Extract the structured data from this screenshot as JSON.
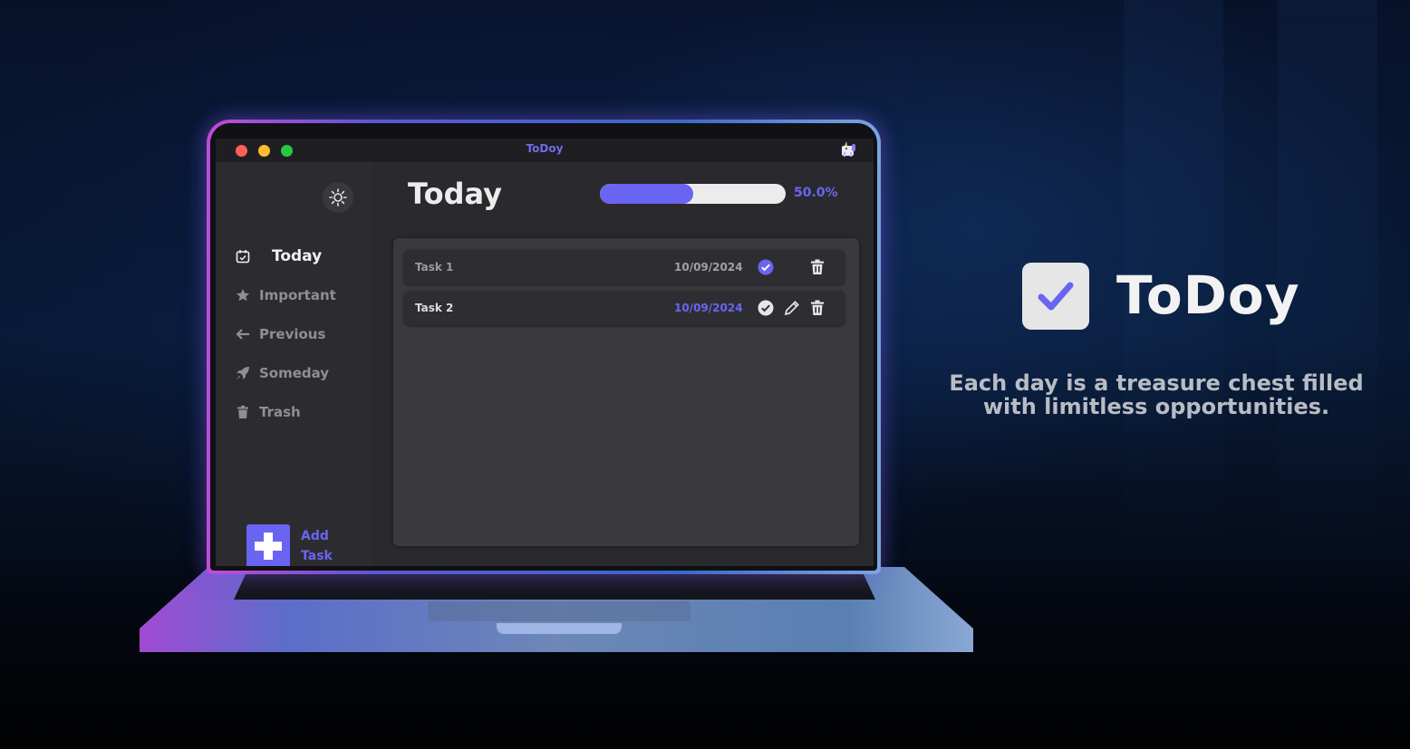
{
  "window": {
    "title": "ToDoy",
    "controls": [
      "close",
      "minimize",
      "maximize"
    ]
  },
  "sidebar": {
    "theme_toggle_icon": "sun-icon",
    "items": [
      {
        "label": "Today",
        "icon": "calendar-icon",
        "active": true
      },
      {
        "label": "Important",
        "icon": "star-icon",
        "active": false
      },
      {
        "label": "Previous",
        "icon": "arrow-left-icon",
        "active": false
      },
      {
        "label": "Someday",
        "icon": "rocket-icon",
        "active": false
      },
      {
        "label": "Trash",
        "icon": "trash-icon",
        "active": false
      }
    ],
    "add_task": {
      "line1": "Add",
      "line2": "Task",
      "icon": "plus-icon"
    }
  },
  "main": {
    "title": "Today",
    "progress": {
      "value": 0.5,
      "label": "50.0%"
    },
    "tasks": [
      {
        "name": "Task 1",
        "date": "10/09/2024",
        "completed": true,
        "actions": [
          "check-circle-icon",
          "trash-icon"
        ]
      },
      {
        "name": "Task 2",
        "date": "10/09/2024",
        "completed": false,
        "actions": [
          "check-circle-icon",
          "pencil-icon",
          "trash-icon"
        ]
      }
    ]
  },
  "branding": {
    "name": "ToDoy",
    "tagline": "Each day is a treasure chest filled with limitless opportunities."
  },
  "colors": {
    "accent": "#6a64f3",
    "close": "#ff5f57",
    "minimize": "#febc2e",
    "maximize": "#28c840"
  }
}
